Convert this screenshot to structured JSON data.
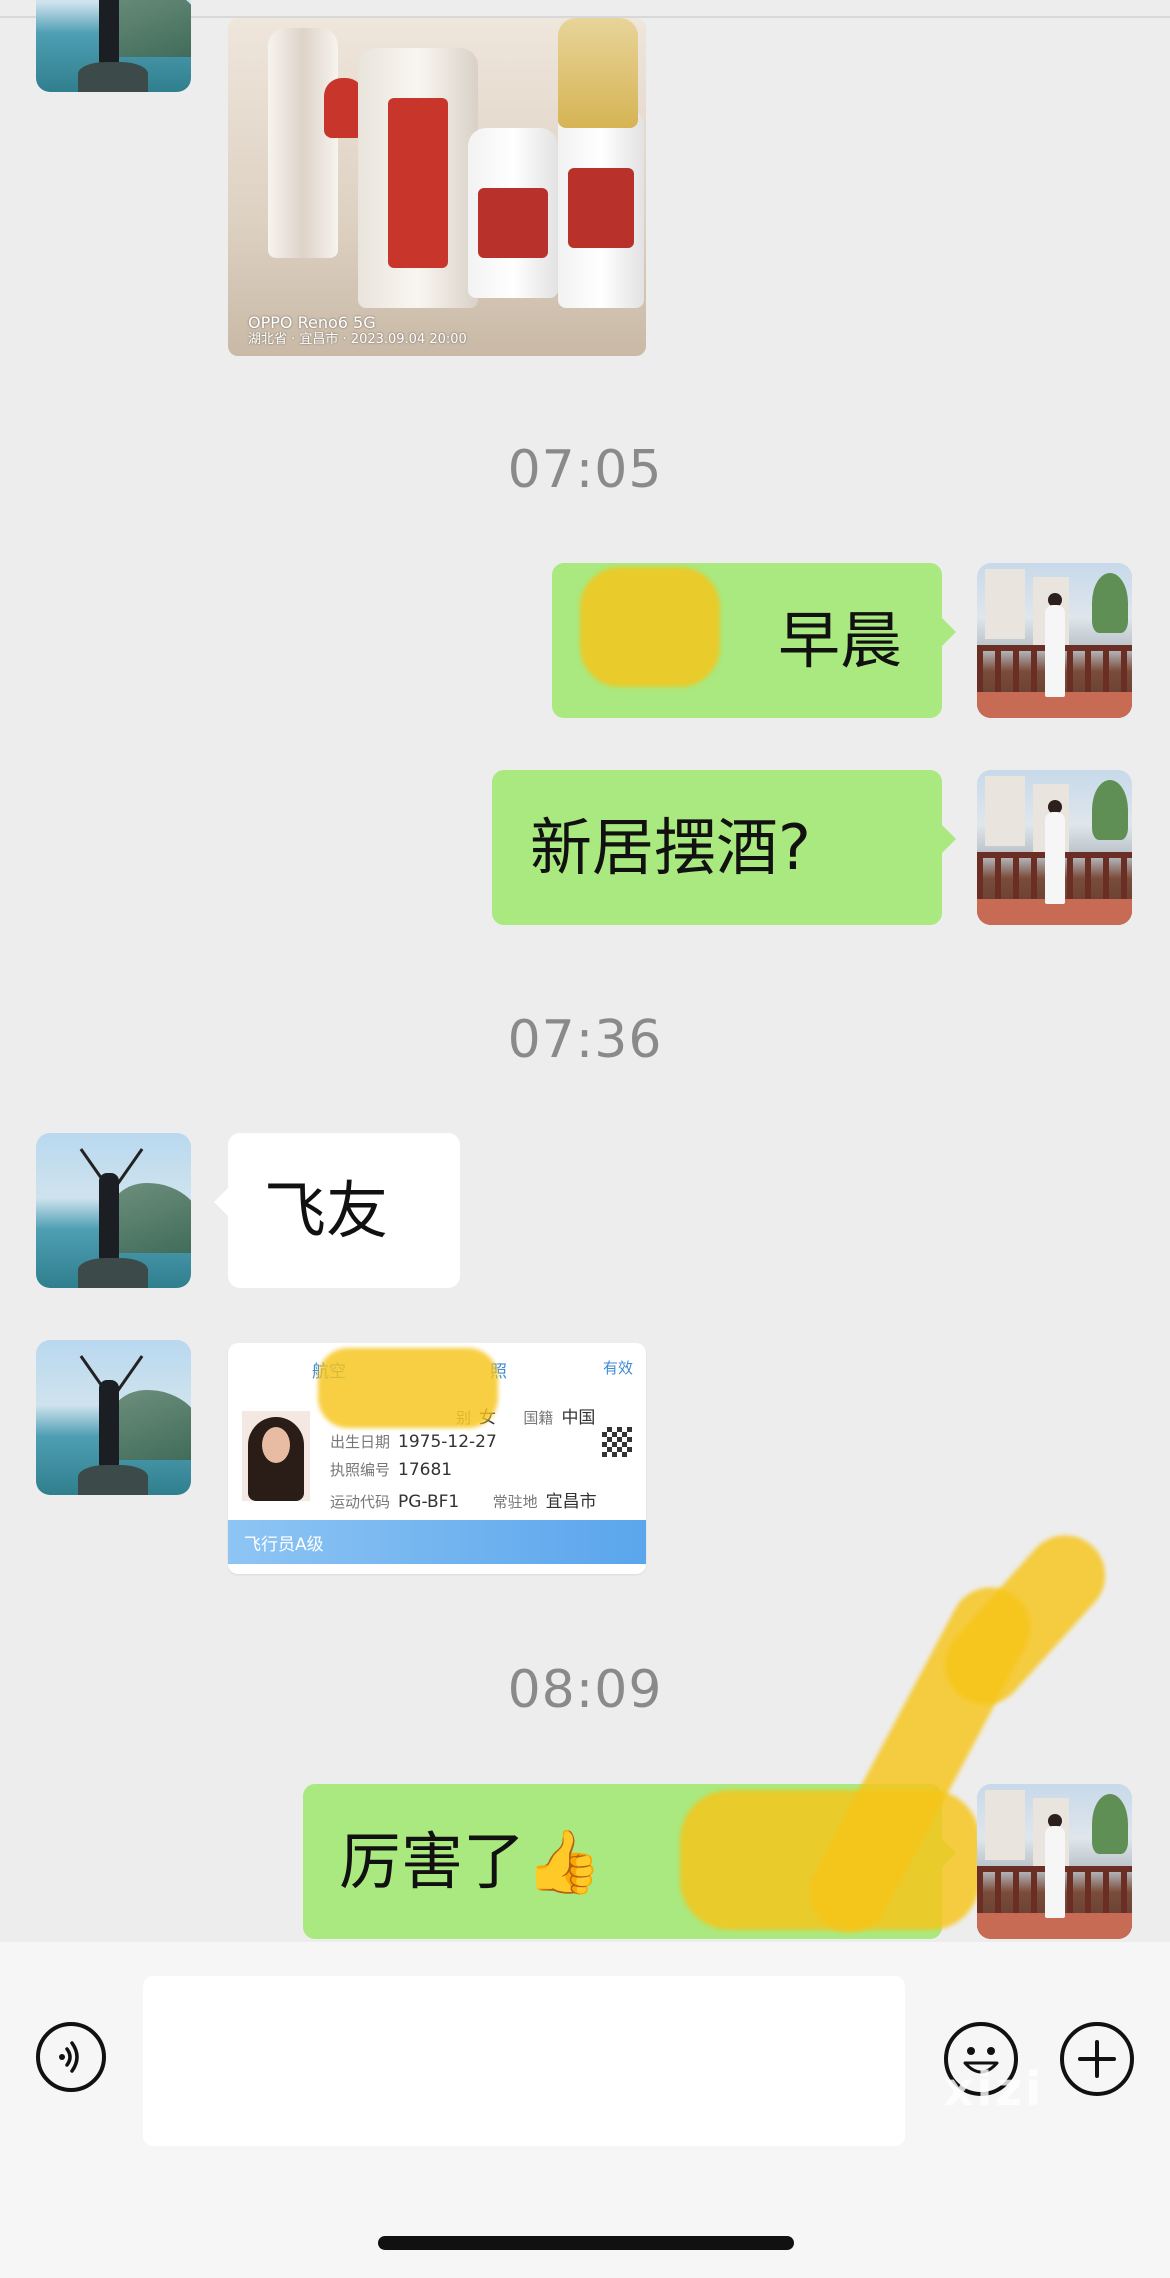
{
  "chat": {
    "photo_message": {
      "watermark_device": "OPPO Reno6 5G",
      "watermark_location": "湖北省 · 宜昌市 · 2023.09.04 20:00"
    },
    "time_1": "07:05",
    "msg_1": "早晨",
    "msg_2": "新居摆酒?",
    "time_2": "07:36",
    "msg_3": "飞友",
    "licence_card": {
      "header_left": "航空",
      "header_mid": "照",
      "header_right": "有效",
      "gender_label": "别",
      "gender_value": "女",
      "nationality_label": "国籍",
      "nationality_value": "中国",
      "birth_label": "出生日期",
      "birth_value": "1975-12-27",
      "licence_no_label": "执照编号",
      "licence_no_value": "17681",
      "sport_code_label": "运动代码",
      "sport_code_value": "PG-BF1",
      "base_label": "常驻地",
      "base_value": "宜昌市",
      "level": "飞行员A级"
    },
    "time_3": "08:09",
    "msg_4": "厉害了👍"
  },
  "input_bar": {
    "voice_icon": "voice-icon",
    "emoji_icon": "emoji-icon",
    "plus_icon": "plus-icon",
    "message_value": ""
  },
  "watermark": "xizi"
}
